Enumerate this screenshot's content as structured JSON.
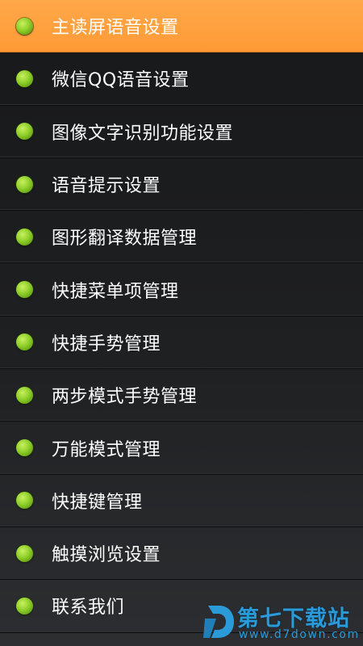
{
  "menu": {
    "items": [
      {
        "label": "主读屏语音设置",
        "selected": true
      },
      {
        "label": "微信QQ语音设置",
        "selected": false
      },
      {
        "label": "图像文字识别功能设置",
        "selected": false
      },
      {
        "label": "语音提示设置",
        "selected": false
      },
      {
        "label": "图形翻译数据管理",
        "selected": false
      },
      {
        "label": "快捷菜单项管理",
        "selected": false
      },
      {
        "label": "快捷手势管理",
        "selected": false
      },
      {
        "label": "两步模式手势管理",
        "selected": false
      },
      {
        "label": "万能模式管理",
        "selected": false
      },
      {
        "label": "快捷键管理",
        "selected": false
      },
      {
        "label": "触摸浏览设置",
        "selected": false
      },
      {
        "label": "联系我们",
        "selected": false
      }
    ]
  },
  "watermark": {
    "title": "第七下载站",
    "url": "www.d7down.com"
  },
  "colors": {
    "selected_bg": "#ff9e3d",
    "bullet": "#8fcf2a",
    "watermark": "#2a9ad8"
  },
  "icons": {
    "bullet": "green-dot-icon",
    "watermark_logo": "d7-logo-icon"
  }
}
